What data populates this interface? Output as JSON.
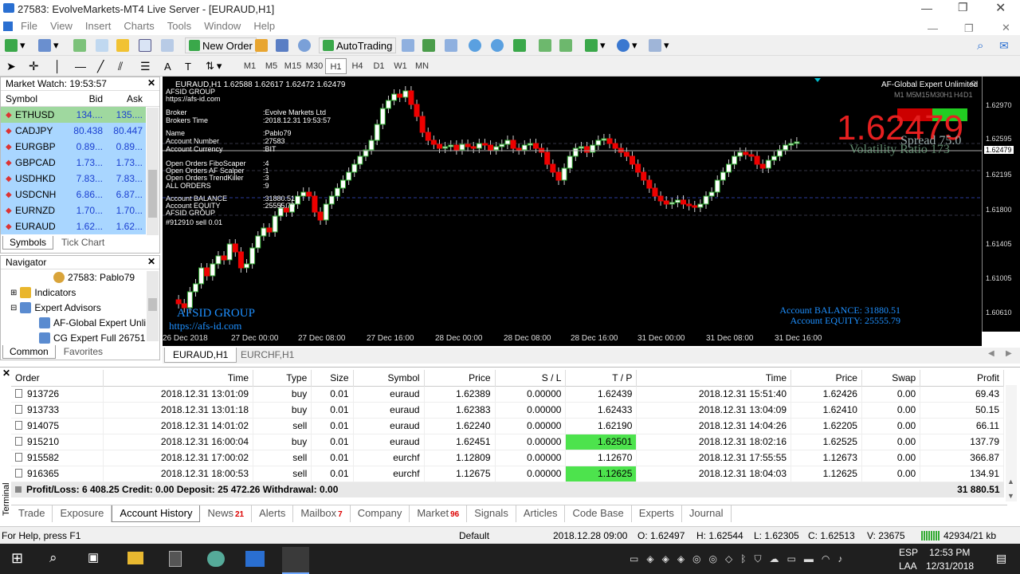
{
  "window": {
    "title": "27583: EvolveMarkets-MT4 Live Server - [EURAUD,H1]"
  },
  "menu": [
    "File",
    "View",
    "Insert",
    "Charts",
    "Tools",
    "Window",
    "Help"
  ],
  "toolbar": {
    "new_order": "New Order",
    "autotrading": "AutoTrading",
    "timeframes": [
      "M1",
      "M5",
      "M15",
      "M30",
      "H1",
      "H4",
      "D1",
      "W1",
      "MN"
    ],
    "active_timeframe": "H1"
  },
  "market_watch": {
    "title": "Market Watch: 19:53:57",
    "headers": [
      "Symbol",
      "Bid",
      "Ask"
    ],
    "rows": [
      {
        "symbol": "ETHUSD",
        "bid": "134....",
        "ask": "135....",
        "color": "#9fd89f"
      },
      {
        "symbol": "CADJPY",
        "bid": "80.438",
        "ask": "80.447",
        "color": "#a9d6ff"
      },
      {
        "symbol": "EURGBP",
        "bid": "0.89...",
        "ask": "0.89...",
        "color": "#a9d6ff"
      },
      {
        "symbol": "GBPCAD",
        "bid": "1.73...",
        "ask": "1.73...",
        "color": "#a9d6ff"
      },
      {
        "symbol": "USDHKD",
        "bid": "7.83...",
        "ask": "7.83...",
        "color": "#a9d6ff"
      },
      {
        "symbol": "USDCNH",
        "bid": "6.86...",
        "ask": "6.87...",
        "color": "#a9d6ff"
      },
      {
        "symbol": "EURNZD",
        "bid": "1.70...",
        "ask": "1.70...",
        "color": "#a9d6ff"
      },
      {
        "symbol": "EURAUD",
        "bid": "1.62...",
        "ask": "1.62...",
        "color": "#a9d6ff"
      }
    ],
    "tabs": [
      "Symbols",
      "Tick Chart"
    ]
  },
  "navigator": {
    "title": "Navigator",
    "items": [
      "27583: Pablo79",
      "Indicators",
      "Expert Advisors",
      "AF-Global Expert Unli",
      "CG Expert Full 26751"
    ],
    "tabs": [
      "Common",
      "Favorites"
    ]
  },
  "chart": {
    "header": "EURAUD,H1  1.62588 1.62617 1.62472 1.62479",
    "info_lines": [
      "AFSID GROUP",
      "https://afs-id.com",
      "Broker",
      "Brokers Time",
      "Name",
      "Account Number",
      "Account Currency",
      "Open Orders FiboScaper",
      "Open Orders AF Scalper",
      "Open Orders TrendKiller",
      "ALL ORDERS",
      "Account BALANCE",
      "Account EQUITY",
      "AFSID GROUP",
      "#912910 sell 0.01"
    ],
    "info_values": [
      ":Evolve Markets Ltd",
      ":2018.12.31 19:53:57",
      ":Pablo79",
      ":27583",
      ":BIT",
      ":4",
      ":1",
      ":3",
      ":9",
      ":31880.51",
      ":25555.79"
    ],
    "ea_name": "AF-Global Expert Unlimited",
    "price_big": "1.62479",
    "spread": "Spread 75.0",
    "volatility": "Volatility Ratio 173",
    "watermark1": "AFSID GROUP",
    "watermark2": "https://afs-id.com",
    "balance_label": "Account BALANCE:",
    "balance_value": "31880.51",
    "equity_label": "Account EQUITY:",
    "equity_value": "25555.79",
    "price_ticks": [
      "1.62970",
      "1.62595",
      "1.62479",
      "1.62195",
      "1.61800",
      "1.61405",
      "1.61005",
      "1.60610"
    ],
    "time_ticks": [
      "26 Dec 2018",
      "27 Dec 00:00",
      "27 Dec 08:00",
      "27 Dec 16:00",
      "28 Dec 00:00",
      "28 Dec 08:00",
      "28 Dec 16:00",
      "31 Dec 00:00",
      "31 Dec 08:00",
      "31 Dec 16:00"
    ],
    "tabs": [
      "EURAUD,H1",
      "EURCHF,H1"
    ]
  },
  "terminal": {
    "headers": [
      "Order",
      "Time",
      "Type",
      "Size",
      "Symbol",
      "Price",
      "S / L",
      "T / P",
      "Time",
      "Price",
      "Swap",
      "Profit"
    ],
    "rows": [
      [
        "913726",
        "2018.12.31 13:01:09",
        "buy",
        "0.01",
        "euraud",
        "1.62389",
        "0.00000",
        "1.62439",
        "2018.12.31 15:51:40",
        "1.62426",
        "0.00",
        "69.43"
      ],
      [
        "913733",
        "2018.12.31 13:01:18",
        "buy",
        "0.01",
        "euraud",
        "1.62383",
        "0.00000",
        "1.62433",
        "2018.12.31 13:04:09",
        "1.62410",
        "0.00",
        "50.15"
      ],
      [
        "914075",
        "2018.12.31 14:01:02",
        "sell",
        "0.01",
        "euraud",
        "1.62240",
        "0.00000",
        "1.62190",
        "2018.12.31 14:04:26",
        "1.62205",
        "0.00",
        "66.11"
      ],
      [
        "915210",
        "2018.12.31 16:00:04",
        "buy",
        "0.01",
        "euraud",
        "1.62451",
        "0.00000",
        "1.62501",
        "2018.12.31 18:02:16",
        "1.62525",
        "0.00",
        "137.79"
      ],
      [
        "915582",
        "2018.12.31 17:00:02",
        "sell",
        "0.01",
        "eurchf",
        "1.12809",
        "0.00000",
        "1.12670",
        "2018.12.31 17:55:55",
        "1.12673",
        "0.00",
        "366.87"
      ],
      [
        "916365",
        "2018.12.31 18:00:53",
        "sell",
        "0.01",
        "eurchf",
        "1.12675",
        "0.00000",
        "1.12625",
        "2018.12.31 18:04:03",
        "1.12625",
        "0.00",
        "134.91"
      ]
    ],
    "highlight_tp_rows": [
      3,
      5
    ],
    "summary": "Profit/Loss: 6 408.25  Credit: 0.00  Deposit: 25 472.26  Withdrawal: 0.00",
    "summary_total": "31 880.51",
    "side_label": "Terminal",
    "tabs": [
      "Trade",
      "Exposure",
      "Account History",
      "News",
      "Alerts",
      "Mailbox",
      "Company",
      "Market",
      "Signals",
      "Articles",
      "Code Base",
      "Experts",
      "Journal"
    ],
    "tab_badges": {
      "News": "21",
      "Mailbox": "7",
      "Market": "96"
    },
    "active_tab": "Account History"
  },
  "status": {
    "help": "For Help, press F1",
    "profile": "Default",
    "datetime": "2018.12.28 09:00",
    "open": "O: 1.62497",
    "high": "H: 1.62544",
    "low": "L: 1.62305",
    "close": "C: 1.62513",
    "volume": "V: 23675",
    "traffic": "42934/21 kb"
  },
  "taskbar": {
    "lang": "ESP",
    "lang2": "LAA",
    "time": "12:53 PM",
    "date": "12/31/2018"
  }
}
